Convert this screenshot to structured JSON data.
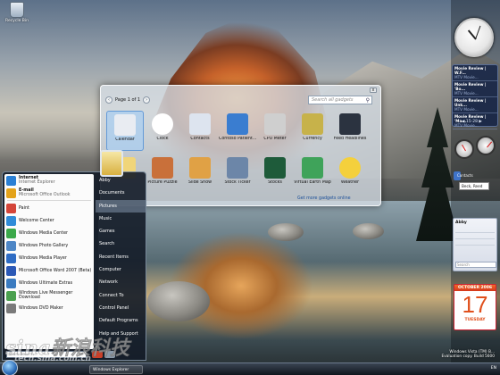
{
  "desktop": {
    "recycle_bin_label": "Recycle Bin"
  },
  "gadget_gallery": {
    "page_label": "Page 1 of 1",
    "search_placeholder": "Search all gadgets",
    "close_glyph": "x",
    "more_link": "Get more gadgets online",
    "gadgets": [
      {
        "label": "Calendar",
        "icon": "calendar-icon",
        "color": "#e9ecf2",
        "selected": true
      },
      {
        "label": "Clock",
        "icon": "clock-icon",
        "color": "#ffffff"
      },
      {
        "label": "Contacts",
        "icon": "contacts-icon",
        "color": "#dde4ef"
      },
      {
        "label": "Contoso Patient...",
        "icon": "contoso-icon",
        "color": "#3a7dd0"
      },
      {
        "label": "CPU Meter",
        "icon": "cpu-meter-icon",
        "color": "#cfcfcf"
      },
      {
        "label": "Currency",
        "icon": "currency-icon",
        "color": "#c7b24a"
      },
      {
        "label": "Feed Headlines",
        "icon": "feed-icon",
        "color": "#2b3340"
      },
      {
        "label": "",
        "icon": "folder-icon",
        "color": "#f0d57a"
      },
      {
        "label": "Picture Puzzle",
        "icon": "puzzle-icon",
        "color": "#c9703a"
      },
      {
        "label": "Slide Show",
        "icon": "slideshow-icon",
        "color": "#e0a145"
      },
      {
        "label": "Stock Ticker",
        "icon": "stock-ticker-icon",
        "color": "#6c86a8"
      },
      {
        "label": "Stocks",
        "icon": "stocks-icon",
        "color": "#1e5b3a"
      },
      {
        "label": "Virtual Earth Map",
        "icon": "map-icon",
        "color": "#3fa35a"
      },
      {
        "label": "Weather",
        "icon": "weather-icon",
        "color": "#f4d03c"
      }
    ]
  },
  "start_menu": {
    "pinned": [
      {
        "title": "Internet",
        "subtitle": "Internet Explorer",
        "color": "#2a7fd4"
      },
      {
        "title": "E-mail",
        "subtitle": "Microsoft Office Outlook",
        "color": "#e3a21a"
      }
    ],
    "programs": [
      {
        "label": "Paint",
        "color": "#d4453a"
      },
      {
        "label": "Welcome Center",
        "color": "#2f8bd8"
      },
      {
        "label": "Windows Media Center",
        "color": "#3ba84a"
      },
      {
        "label": "Windows Photo Gallery",
        "color": "#4d86c6"
      },
      {
        "label": "Windows Media Player",
        "color": "#2e6cc4"
      },
      {
        "label": "Microsoft Office Word 2007 (Beta)",
        "color": "#2b58b6"
      },
      {
        "label": "Windows Ultimate Extras",
        "color": "#3b7bc0"
      },
      {
        "label": "Windows Live Messenger Download",
        "color": "#4aa04e"
      },
      {
        "label": "Windows DVD Maker",
        "color": "#7a7a7a"
      }
    ],
    "right_items": [
      {
        "label": "Abby"
      },
      {
        "label": "Documents"
      },
      {
        "label": "Pictures",
        "highlight": true
      },
      {
        "label": "Music"
      },
      {
        "label": "Games"
      },
      {
        "label": "Search"
      },
      {
        "label": "Recent Items"
      },
      {
        "label": "Computer"
      },
      {
        "label": "Network"
      },
      {
        "label": "Connect To"
      },
      {
        "label": "Control Panel"
      },
      {
        "label": "Default Programs"
      },
      {
        "label": "Help and Support"
      }
    ],
    "search_placeholder": "Start Search"
  },
  "sidebar": {
    "feed_items": [
      {
        "title": "Movie Review | W.F...",
        "meta": "MTV Movie..."
      },
      {
        "title": "Movie Review | 'Bo...",
        "meta": "MTV Movie..."
      },
      {
        "title": "Movie Review | Unk...",
        "meta": "MTV Movie..."
      },
      {
        "title": "Movie Review | 'Ma...",
        "meta": "MTV Movie..."
      }
    ],
    "feed_nav": "15-28",
    "contacts_title": "Contacts",
    "contacts_name": "Beck, Reed",
    "notes_text": "Abby",
    "notes_search": "Search",
    "calendar": {
      "month_year": "OCTOBER 2006",
      "day": "17",
      "weekday": "TUESDAY"
    }
  },
  "taskbar": {
    "item_label": "Windows Explorer",
    "tray_text": "EN"
  },
  "build_text": {
    "line1": "Windows Vista (TM) B...",
    "line2": "Evaluation copy. Build 5600"
  },
  "watermark": {
    "main": "sina新浪科技",
    "sub": "tech.sina.com.cn"
  }
}
